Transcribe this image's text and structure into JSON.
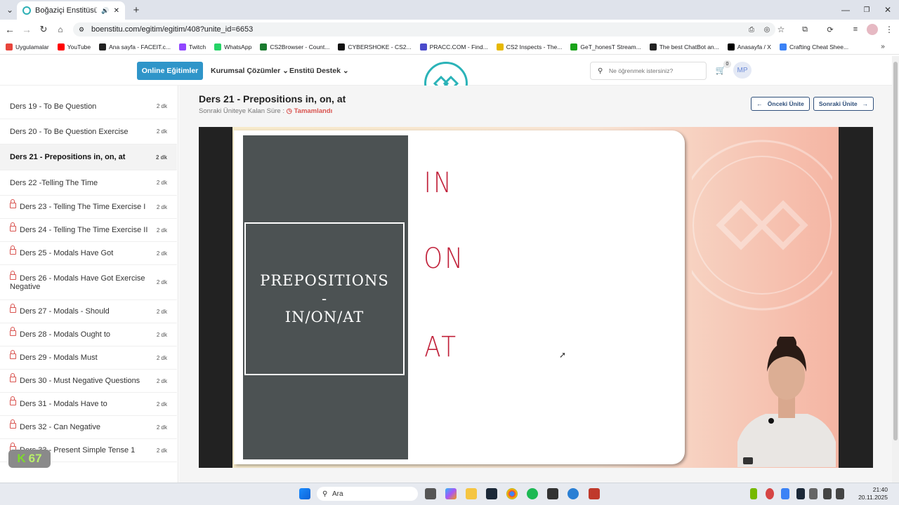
{
  "browser": {
    "tab_title": "Boğaziçi Enstitüsü | EGITIM",
    "url": "boenstitu.com/egitim/egitim/408?unite_id=6653",
    "bookmarks": [
      {
        "label": "Uygulamalar",
        "color": "#e8453c"
      },
      {
        "label": "YouTube",
        "color": "#ff0000"
      },
      {
        "label": "Ana sayfa - FACEIT.c...",
        "color": "#222222"
      },
      {
        "label": "Twitch",
        "color": "#9146ff"
      },
      {
        "label": "WhatsApp",
        "color": "#25d366"
      },
      {
        "label": "CS2Browser - Count...",
        "color": "#1a7a2e"
      },
      {
        "label": "CYBERSHOKE - CS2...",
        "color": "#111111"
      },
      {
        "label": "PRACC.COM - Find...",
        "color": "#4a4acb"
      },
      {
        "label": "CS2 Inspects - The...",
        "color": "#e6b800"
      },
      {
        "label": "GeT_honesT Stream...",
        "color": "#1aa31a"
      },
      {
        "label": "The best ChatBot an...",
        "color": "#222222"
      },
      {
        "label": "Anasayfa / X",
        "color": "#000000"
      },
      {
        "label": "Crafting Cheat Shee...",
        "color": "#3b82f6"
      }
    ]
  },
  "site": {
    "online_button": "Online Eğitimler",
    "nav": [
      "Kurumsal Çözümler",
      "Enstitü Destek"
    ],
    "search_placeholder": "Ne öğrenmek istersiniz?",
    "cart_count": "0",
    "avatar_initials": "MP"
  },
  "lessons": [
    {
      "label": "Ders 19 - To Be Question",
      "duration": "2 dk",
      "locked": false,
      "active": false
    },
    {
      "label": "Ders 20 - To Be Question Exercise",
      "duration": "2 dk",
      "locked": false,
      "active": false
    },
    {
      "label": "Ders 21 - Prepositions in, on, at",
      "duration": "2 dk",
      "locked": false,
      "active": true
    },
    {
      "label": "Ders 22 -Telling The Time",
      "duration": "2 dk",
      "locked": false,
      "active": false
    },
    {
      "label": "Ders 23 - Telling The Time Exercise I",
      "duration": "2 dk",
      "locked": true,
      "active": false
    },
    {
      "label": "Ders 24 - Telling The Time Exercise II",
      "duration": "2 dk",
      "locked": true,
      "active": false
    },
    {
      "label": "Ders 25 - Modals Have Got",
      "duration": "2 dk",
      "locked": true,
      "active": false
    },
    {
      "label": "Ders 26 - Modals Have Got Exercise Negative",
      "duration": "2 dk",
      "locked": true,
      "active": false
    },
    {
      "label": "Ders 27 - Modals - Should",
      "duration": "2 dk",
      "locked": true,
      "active": false
    },
    {
      "label": "Ders 28 - Modals Ought to",
      "duration": "2 dk",
      "locked": true,
      "active": false
    },
    {
      "label": "Ders 29 - Modals Must",
      "duration": "2 dk",
      "locked": true,
      "active": false
    },
    {
      "label": "Ders 30 - Must Negative Questions",
      "duration": "2 dk",
      "locked": true,
      "active": false
    },
    {
      "label": "Ders 31 - Modals Have to",
      "duration": "2 dk",
      "locked": true,
      "active": false
    },
    {
      "label": "Ders 32 - Can Negative",
      "duration": "2 dk",
      "locked": true,
      "active": false
    },
    {
      "label": "Ders 33 - Present Simple Tense 1",
      "duration": "2 dk",
      "locked": true,
      "active": false
    }
  ],
  "main": {
    "title": "Ders 21 - Prepositions in, on, at",
    "remaining_label": "Sonraki Üniteye Kalan Süre :",
    "remaining_status": "Tamamlandı",
    "prev_button": "Önceki Ünite",
    "next_button": "Sonraki Ünite"
  },
  "slide": {
    "heading_line1": "PREPOSITIONS",
    "heading_line2": "-",
    "heading_line3": "IN/ON/AT",
    "hand_in": "IN",
    "hand_on": "ON",
    "hand_at": "AT"
  },
  "overlay_badge": {
    "letter": "K",
    "value": "67"
  },
  "taskbar": {
    "search": "Ara",
    "time": "21:40",
    "date": "20.11.2025"
  }
}
